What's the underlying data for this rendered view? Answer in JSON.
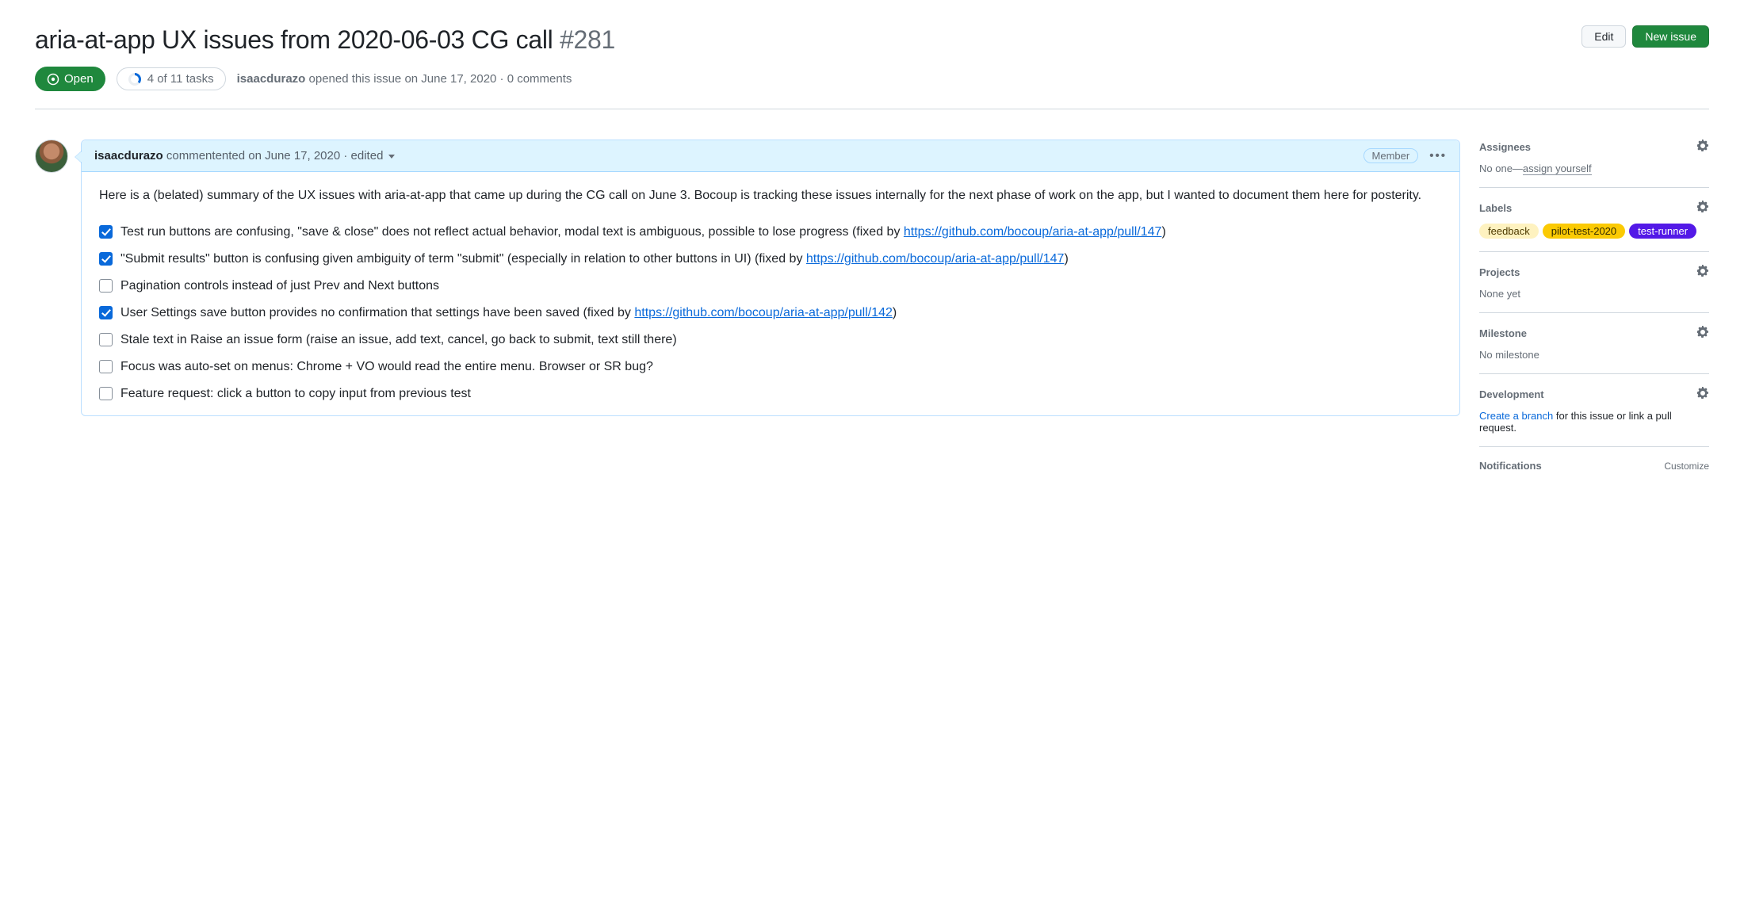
{
  "header": {
    "title": "aria-at-app UX issues from 2020-06-03 CG call",
    "issue_number": "#281",
    "edit_btn": "Edit",
    "new_issue_btn": "New issue",
    "state": "Open",
    "tasks": "4 of 11 tasks",
    "author": "isaacdurazo",
    "opened_rest": " opened this issue on June 17, 2020 · 0 comments"
  },
  "comment": {
    "author": "isaacdurazo",
    "meta_rest": " commentented on June 17, 2020 · edited ",
    "role": "Member",
    "intro": "Here is a (belated) summary of the UX issues with aria-at-app that came up during the CG call on June 3. Bocoup is tracking these issues internally for the next phase of work on the app, but I wanted to document them here for posterity.",
    "tasks": [
      {
        "checked": true,
        "text_a": "Test run buttons are confusing, \"save & close\" does not reflect actual behavior, modal text is ambiguous, possible to lose progress (fixed by ",
        "link": "https://github.com/bocoup/aria-at-app/pull/147",
        "text_b": ")"
      },
      {
        "checked": true,
        "text_a": "\"Submit results\" button is confusing given ambiguity of term \"submit\" (especially in relation to other buttons in UI) (fixed by ",
        "link": "https://github.com/bocoup/aria-at-app/pull/147",
        "text_b": ")"
      },
      {
        "checked": false,
        "text_a": "Pagination controls instead of just Prev and Next buttons",
        "link": "",
        "text_b": ""
      },
      {
        "checked": true,
        "text_a": "User Settings save button provides no confirmation that settings have been saved (fixed by ",
        "link": "https://github.com/bocoup/aria-at-app/pull/142",
        "text_b": ")"
      },
      {
        "checked": false,
        "text_a": "Stale text in Raise an issue form (raise an issue, add text, cancel, go back to submit, text still there)",
        "link": "",
        "text_b": ""
      },
      {
        "checked": false,
        "text_a": "Focus was auto-set on menus: Chrome + VO would read the entire menu. Browser or SR bug?",
        "link": "",
        "text_b": ""
      },
      {
        "checked": false,
        "text_a": "Feature request: click a button to copy input from previous test",
        "link": "",
        "text_b": ""
      }
    ]
  },
  "sidebar": {
    "assignees": {
      "heading": "Assignees",
      "prefix": "No one—",
      "link": "assign yourself"
    },
    "labels": {
      "heading": "Labels",
      "items": [
        "feedback",
        "pilot-test-2020",
        "test-runner"
      ]
    },
    "projects": {
      "heading": "Projects",
      "body": "None yet"
    },
    "milestone": {
      "heading": "Milestone",
      "body": "No milestone"
    },
    "development": {
      "heading": "Development",
      "link": "Create a branch",
      "rest": " for this issue or link a pull request."
    },
    "notifications": {
      "heading": "Notifications",
      "customize": "Customize"
    }
  }
}
